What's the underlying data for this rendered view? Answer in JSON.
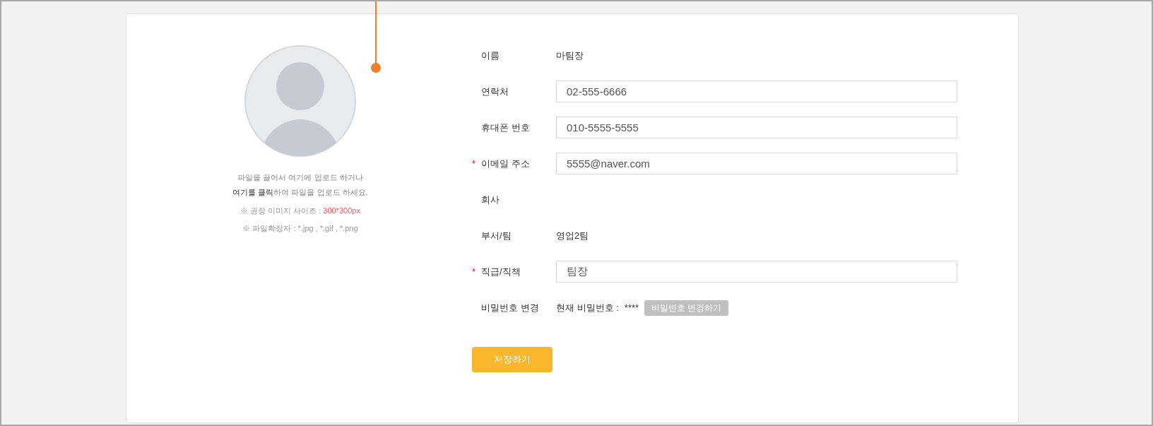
{
  "upload": {
    "lines": [
      "파일을 끌어서 여기에 업로드 하거나",
      "**여기를 클릭**하여 파일을 업로드 하세요."
    ],
    "size_note": "※ 권장 이미지 사이즈 : ",
    "size_value": "300*300px",
    "ext_note": "※ 파일확장자 : *.jpg , *.gif , *.png"
  },
  "fields": [
    {
      "label": "이름",
      "kind": "text",
      "required": false,
      "value": "마팀장"
    },
    {
      "label": "연락처",
      "kind": "input",
      "required": false,
      "value": "02-555-6666"
    },
    {
      "label": "휴대폰 번호",
      "kind": "input",
      "required": false,
      "value": "010-5555-5555"
    },
    {
      "label": "이메일 주소",
      "kind": "input",
      "required": true,
      "value": "5555@naver.com"
    },
    {
      "label": "회사",
      "kind": "empty",
      "required": false
    },
    {
      "label": "부서/팀",
      "kind": "text",
      "required": false,
      "value": "영업2팀"
    },
    {
      "label": "직급/직책",
      "kind": "input",
      "required": true,
      "value": "팀장"
    },
    {
      "label": "비밀번호 변경",
      "kind": "password",
      "required": false,
      "value": "현재 비밀번호 :",
      "masked": "****",
      "button": "비밀번호 변경하기"
    }
  ],
  "required_mark": "*",
  "save_button": "저장하기"
}
